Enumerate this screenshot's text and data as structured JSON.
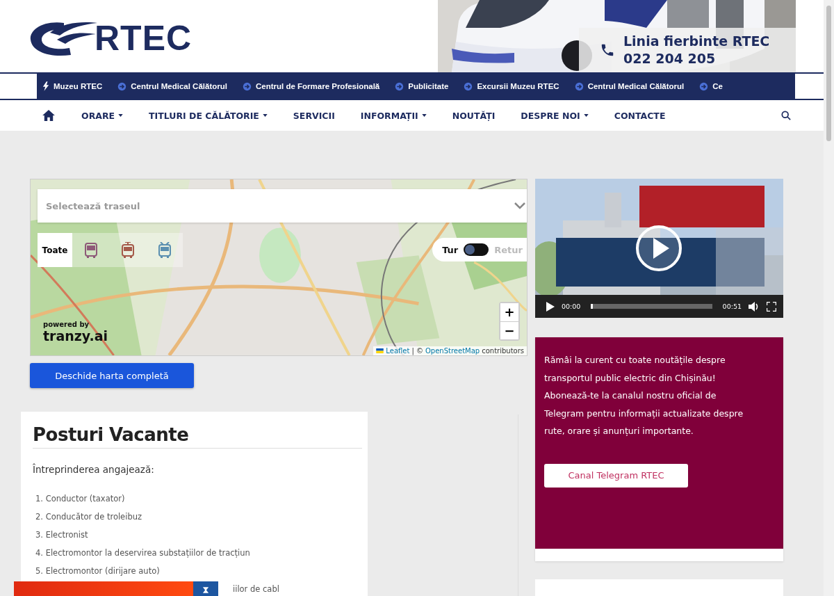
{
  "logo": {
    "text": "RTEC"
  },
  "hotline": {
    "title": "Linia fierbinte RTEC",
    "phone": "022 204 205"
  },
  "ticker": [
    {
      "label": "Muzeu RTEC",
      "kind": "bolt"
    },
    {
      "label": "Centrul Medical Călătorul",
      "kind": "arrow"
    },
    {
      "label": "Centrul de Formare Profesională",
      "kind": "arrow"
    },
    {
      "label": "Publicitate",
      "kind": "arrow"
    },
    {
      "label": "Excursii Muzeu RTEC",
      "kind": "arrow"
    },
    {
      "label": "Centrul Medical Călătorul",
      "kind": "arrow"
    },
    {
      "label": "Ce",
      "kind": "arrow"
    }
  ],
  "nav": [
    {
      "label": "ORARE",
      "has_menu": true
    },
    {
      "label": "TITLURI DE CĂLĂTORIE",
      "has_menu": true
    },
    {
      "label": "SERVICII",
      "has_menu": false
    },
    {
      "label": "INFORMAȚII",
      "has_menu": true
    },
    {
      "label": "NOUTĂȚI",
      "has_menu": false
    },
    {
      "label": "DESPRE NOI",
      "has_menu": true
    },
    {
      "label": "CONTACTE",
      "has_menu": false
    }
  ],
  "map": {
    "route_select": {
      "placeholder": "Selectează traseul"
    },
    "filters": [
      {
        "label": "Toate",
        "kind": "text",
        "selected": true
      },
      {
        "kind": "bus",
        "selected": false,
        "color": "#8e5a78"
      },
      {
        "kind": "tram",
        "selected": false,
        "color": "#a55a4a"
      },
      {
        "kind": "trolley",
        "selected": false,
        "color": "#5a8fb0"
      }
    ],
    "direction": {
      "left": "Tur",
      "right": "Retur",
      "on": false
    },
    "zoom": [
      "+",
      "−"
    ],
    "powered_by": "powered by",
    "brand": "tranzy.ai",
    "attribution": {
      "leaflet": "Leaflet",
      "sep": "| ©",
      "osm": "OpenStreetMap",
      "rest": "contributors"
    }
  },
  "open_map_button": "Deschide harta completă",
  "vacancies": {
    "title": "Posturi Vacante",
    "intro": "Întreprinderea angajează:",
    "items": [
      {
        "number": "1.",
        "text": "Conductor (taxator)"
      },
      {
        "number": "2.",
        "text": "Conducător de troleibuz"
      },
      {
        "number": "3.",
        "text": "Electronist"
      },
      {
        "number": "4.",
        "text": "Electromontor la deservirea substațiilor de tracțiun"
      },
      {
        "number": "5.",
        "text": "Electromontor (dirijare auto)"
      }
    ],
    "partial_item": "iilor de cabl"
  },
  "video": {
    "current": "00:00",
    "duration": "00:51",
    "level": 0.01
  },
  "telegram": {
    "text": "Rămâi la curent cu toate noutățile despre transportul public electric din Chișinău! Abonează-te la canalul nostru oficial de Telegram pentru informații actualizate despre rute, orare și anunțuri importante.",
    "button": "Canal Telegram RTEC"
  }
}
